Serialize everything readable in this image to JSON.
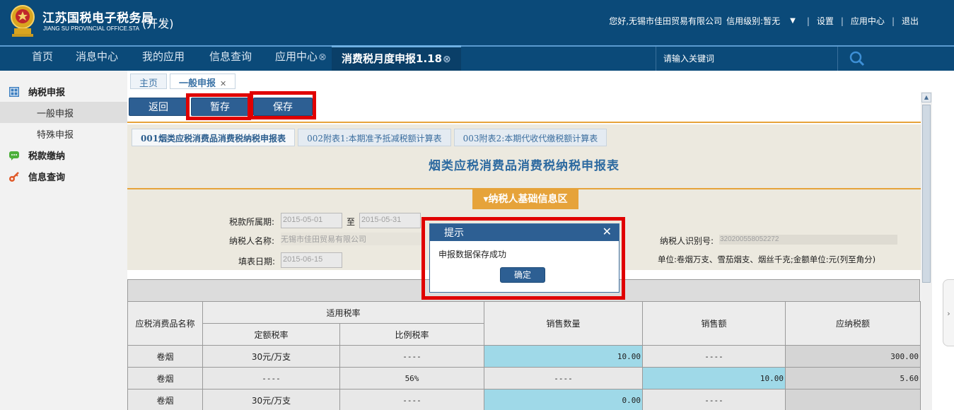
{
  "header": {
    "logo_cn": "江苏国税电子税务局",
    "logo_en": "JIANG SU PROVINCIAL OFFICE.STA",
    "logo_sub": "(开发)",
    "greeting": "您好,无锡市佳田贸易有限公司",
    "credit": "信用级别:暂无",
    "links": [
      "设置",
      "应用中心",
      "退出"
    ]
  },
  "nav": {
    "items": [
      "首页",
      "消息中心",
      "我的应用",
      "信息查询",
      "应用中心"
    ],
    "active": "消费税月度申报1.18",
    "search_placeholder": "请输入关键词"
  },
  "sidebar": {
    "groups": [
      {
        "label": "纳税申报",
        "icon": "grid-icon",
        "color": "#3b7ec0"
      },
      {
        "label": "税款缴纳",
        "icon": "chat-icon",
        "color": "#4caf3a"
      },
      {
        "label": "信息查询",
        "icon": "key-icon",
        "color": "#e05a2a"
      }
    ],
    "subitems": [
      "一般申报",
      "特殊申报"
    ]
  },
  "tabs": [
    "主页",
    "一般申报"
  ],
  "toolbar": {
    "back": "返回",
    "temp_save": "暂存",
    "save": "保存"
  },
  "subtabs": [
    "001烟类应税消费品消费税纳税申报表",
    "002附表1:本期准予抵减税额计算表",
    "003附表2:本期代收代缴税额计算表"
  ],
  "form": {
    "title": "烟类应税消费品消费税纳税申报表",
    "section": "纳税人基础信息区",
    "period_label": "税款所属期:",
    "period_from": "2015-05-01",
    "period_to_label": "至",
    "period_to": "2015-05-31",
    "name_label": "纳税人名称:",
    "name_value": "无锡市佳田贸易有限公司",
    "date_label": "填表日期:",
    "date_value": "2015-06-15",
    "id_label": "纳税人识别号:",
    "id_value": "320200558052272",
    "unit_note": "单位:卷烟万支、雪茄烟支、烟丝千克;金额单位:元(列至角分)"
  },
  "table": {
    "headers": {
      "name": "应税消费品名称",
      "rate_group": "适用税率",
      "fixed_rate": "定额税率",
      "ratio_rate": "比例税率",
      "qty": "销售数量",
      "amount": "销售额",
      "tax": "应纳税额"
    },
    "rows": [
      {
        "name": "卷烟",
        "fixed": "30元/万支",
        "ratio": "----",
        "qty": "10.00",
        "amount": "----",
        "tax": "300.00"
      },
      {
        "name": "卷烟",
        "fixed": "----",
        "ratio": "56%",
        "qty": "----",
        "amount": "10.00",
        "tax": "5.60"
      },
      {
        "name": "卷烟",
        "fixed": "30元/万支",
        "ratio": "----",
        "qty": "0.00",
        "amount": "----",
        "tax": ""
      }
    ]
  },
  "dialog": {
    "title": "提示",
    "message": "申报数据保存成功",
    "ok": "确定"
  }
}
